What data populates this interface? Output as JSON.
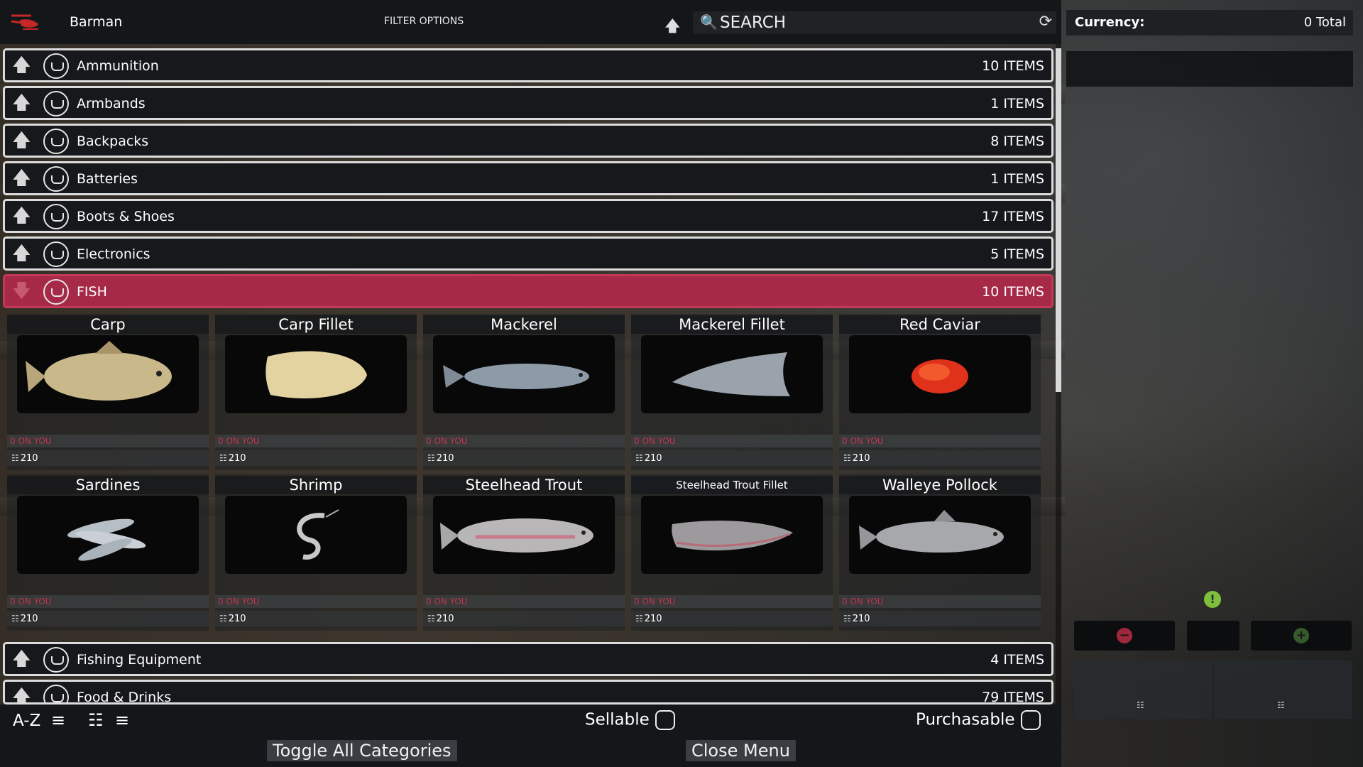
{
  "header": {
    "vendor_name": "Barman",
    "filter_options": "FILTER OPTIONS",
    "search_placeholder": "SEARCH"
  },
  "currency": {
    "label": "Currency:",
    "total": "0 Total"
  },
  "categories_top": [
    {
      "name": "Ammunition",
      "count": "10 ITEMS"
    },
    {
      "name": "Armbands",
      "count": "1 ITEMS"
    },
    {
      "name": "Backpacks",
      "count": "8 ITEMS"
    },
    {
      "name": "Batteries",
      "count": "1 ITEMS"
    },
    {
      "name": "Boots & Shoes",
      "count": "17 ITEMS"
    },
    {
      "name": "Electronics",
      "count": "5 ITEMS"
    },
    {
      "name": "FISH",
      "count": "10 ITEMS"
    }
  ],
  "categories_bottom": [
    {
      "name": "Fishing Equipment",
      "count": "4 ITEMS"
    },
    {
      "name": "Food & Drinks",
      "count": "79 ITEMS"
    }
  ],
  "items": [
    {
      "name": "Carp",
      "on_you": "0 ON YOU",
      "price": "210"
    },
    {
      "name": "Carp Fillet",
      "on_you": "0 ON YOU",
      "price": "210"
    },
    {
      "name": "Mackerel",
      "on_you": "0 ON YOU",
      "price": "210"
    },
    {
      "name": "Mackerel Fillet",
      "on_you": "0 ON YOU",
      "price": "210"
    },
    {
      "name": "Red Caviar",
      "on_you": "0 ON YOU",
      "price": "210"
    },
    {
      "name": "Sardines",
      "on_you": "0 ON YOU",
      "price": "210"
    },
    {
      "name": "Shrimp",
      "on_you": "0 ON YOU",
      "price": "210"
    },
    {
      "name": "Steelhead Trout",
      "on_you": "0 ON YOU",
      "price": "210"
    },
    {
      "name": "Steelhead Trout Fillet",
      "on_you": "0 ON YOU",
      "price": "210"
    },
    {
      "name": "Walleye Pollock",
      "on_you": "0 ON YOU",
      "price": "210"
    }
  ],
  "bottom": {
    "sort_az": "A-Z",
    "sellable": "Sellable",
    "purchasable": "Purchasable",
    "toggle_all": "Toggle All Categories",
    "close_menu": "Close Menu"
  },
  "icons": {
    "vendor": "helicopter-icon",
    "sort": "arrow-up-icon",
    "search": "search-icon",
    "refresh": "refresh-icon",
    "category": "hand-coin-icon",
    "coin": "coin-stack-icon"
  },
  "colors": {
    "active_category": "#a62a47",
    "on_you_text": "#c0364f",
    "minus_button": "#a0283c",
    "plus_button": "#355a2c"
  }
}
